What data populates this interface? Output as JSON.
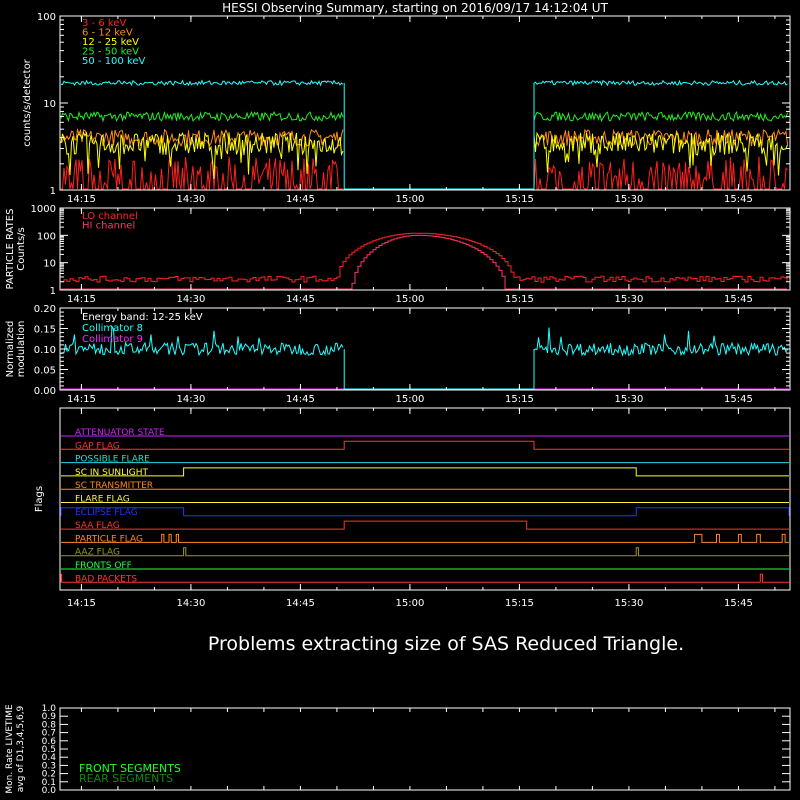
{
  "title": "HESSI Observing Summary, starting on 2016/09/17 14:12:04 UT",
  "colors": {
    "background": "#000000",
    "axes": "#ffffff",
    "band_3_6": "#ff2020",
    "band_6_12": "#ff8c1a",
    "band_12_25": "#ffff00",
    "band_25_50": "#22ee22",
    "band_50_100": "#22ffff",
    "lo_channel": "#ff2222",
    "hi_channel": "#ff3366",
    "collimator": "#22ffff",
    "magenta": "#ff22ff",
    "front_segments": "#22ff22",
    "rear_segments": "#118811"
  },
  "time_ticks": [
    "14:15",
    "14:30",
    "14:45",
    "15:00",
    "15:15",
    "15:30",
    "15:45"
  ],
  "message": "Problems extracting size of SAS Reduced Triangle.",
  "chart_data": [
    {
      "type": "line",
      "panel": "count_rates",
      "ylabel": "counts/s/detector",
      "yscale": "log",
      "ylim": [
        1,
        100
      ],
      "yticks": [
        "1",
        "10",
        "100"
      ],
      "xlim": [
        "14:12:04",
        "15:52:04"
      ],
      "data_gap": [
        "14:51",
        "15:17"
      ],
      "series": [
        {
          "name": "3 - 6 keV",
          "level": 1.4,
          "color": "#ff2020"
        },
        {
          "name": "6 - 12 keV",
          "level": 4.0,
          "color": "#ff8c1a"
        },
        {
          "name": "12 - 25 keV",
          "level": 3.4,
          "color": "#ffff00"
        },
        {
          "name": "25 - 50 keV",
          "level": 7.0,
          "color": "#22ee22"
        },
        {
          "name": "50 - 100 keV",
          "level": 17.0,
          "color": "#22ffff"
        }
      ]
    },
    {
      "type": "line",
      "panel": "particle_rates",
      "ylabel": "PARTICLE RATES",
      "ylabel2": "Counts/s",
      "yscale": "log",
      "ylim": [
        1,
        1000
      ],
      "yticks": [
        "1",
        "10",
        "100",
        "1000"
      ],
      "series": [
        {
          "name": "LO channel",
          "color": "#ff2222",
          "baseline": 2.5,
          "peak": 120,
          "peak_time": "15:01",
          "rise": "14:50",
          "fall": "15:14"
        },
        {
          "name": "HI channel",
          "color": "#ff3366",
          "baseline": 1.0,
          "peak": 100,
          "peak_time": "15:01",
          "rise": "14:52",
          "fall": "15:13"
        }
      ]
    },
    {
      "type": "line",
      "panel": "modulation",
      "ylabel": "Normalized",
      "ylabel2": "modulation",
      "ylim": [
        0,
        0.2
      ],
      "yticks": [
        "0.00",
        "0.05",
        "0.10",
        "0.15",
        "0.20"
      ],
      "energy_band": "Energy band: 12-25 keV",
      "series": [
        {
          "name": "Collimator 8",
          "color": "#22ffff",
          "level": 0.1
        },
        {
          "name": "Collimator 9",
          "color": "#ff22ff",
          "level": 0.0
        }
      ]
    },
    {
      "type": "line",
      "panel": "flags",
      "ylabel": "Flags",
      "series": [
        {
          "name": "ATTENUATOR STATE",
          "color": "#cc22ff",
          "on": []
        },
        {
          "name": "GAP FLAG",
          "color": "#ff3333",
          "on": [
            [
              "14:51",
              "15:17"
            ]
          ]
        },
        {
          "name": "POSSIBLE FLARE",
          "color": "#22dddd",
          "on": []
        },
        {
          "name": "SC IN SUNLIGHT",
          "color": "#ffff22",
          "on": [
            [
              "14:29",
              "15:31"
            ]
          ]
        },
        {
          "name": "SC TRANSMITTER",
          "color": "#ff8822",
          "on": []
        },
        {
          "name": "FLARE FLAG",
          "color": "#ffee44",
          "on": []
        },
        {
          "name": "ECLIPSE FLAG",
          "color": "#2233ff",
          "on": [
            [
              "14:12",
              "14:29"
            ],
            [
              "15:31",
              "15:52"
            ]
          ]
        },
        {
          "name": "SAA FLAG",
          "color": "#ff3333",
          "on": [
            [
              "14:51",
              "15:16"
            ]
          ]
        },
        {
          "name": "PARTICLE FLAG",
          "color": "#ff8822",
          "on": [
            [
              "14:26",
              "14:26.3"
            ],
            [
              "14:27",
              "14:27.3"
            ],
            [
              "14:28",
              "14:28.3"
            ],
            [
              "15:39",
              "15:40"
            ],
            [
              "15:42",
              "15:42.4"
            ],
            [
              "15:45",
              "15:45.4"
            ],
            [
              "15:47.5",
              "15:48"
            ],
            [
              "15:51",
              "15:51.4"
            ]
          ]
        },
        {
          "name": "AAZ FLAG",
          "color": "#999922",
          "on": [
            [
              "14:29",
              "14:29.3"
            ],
            [
              "15:31",
              "15:31.3"
            ]
          ]
        },
        {
          "name": "FRONTS OFF",
          "color": "#22ff44",
          "on": []
        },
        {
          "name": "BAD PACKETS",
          "color": "#ff3333",
          "on": [
            [
              "14:12",
              "14:12.3"
            ],
            [
              "15:48",
              "15:48.3"
            ]
          ]
        }
      ]
    },
    {
      "type": "line",
      "panel": "livetime",
      "ylabel": "Mon. Rate LIVETIME",
      "ylabel2": "avg of D1,3,4,5,6,9",
      "ylim": [
        0,
        1
      ],
      "yticks": [
        "0.0",
        "0.1",
        "0.2",
        "0.3",
        "0.4",
        "0.5",
        "0.6",
        "0.7",
        "0.8",
        "0.9",
        "1.0"
      ],
      "series": [
        {
          "name": "FRONT SEGMENTS",
          "color": "#22ff22"
        },
        {
          "name": "REAR SEGMENTS",
          "color": "#118811"
        }
      ]
    }
  ]
}
